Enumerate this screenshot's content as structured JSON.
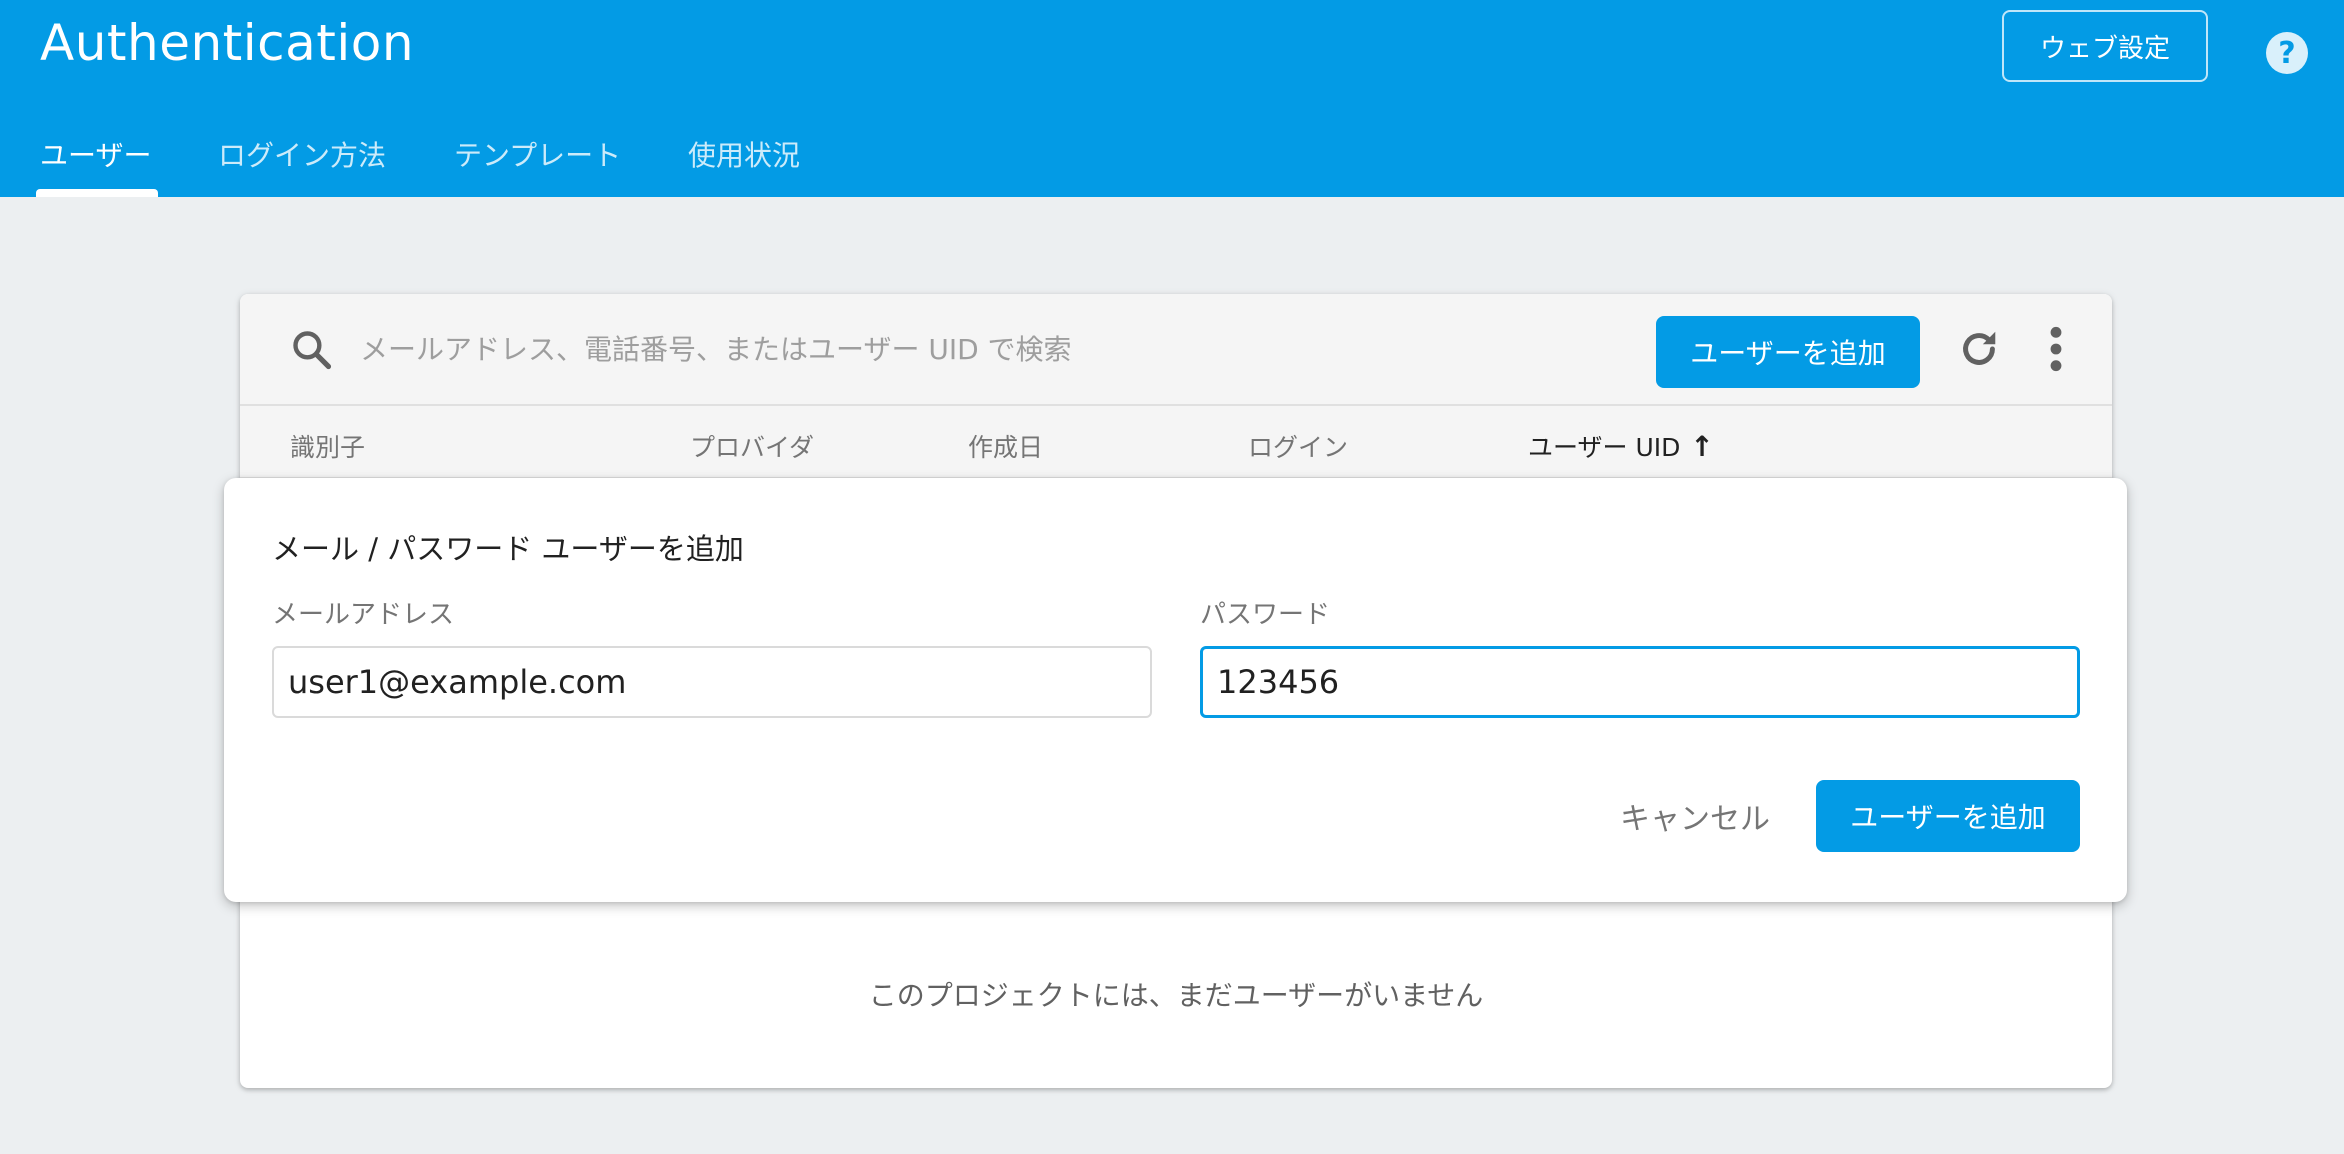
{
  "header": {
    "title": "Authentication",
    "web_settings_label": "ウェブ設定",
    "help_glyph": "?"
  },
  "tabs": [
    {
      "label": "ユーザー",
      "active": true
    },
    {
      "label": "ログイン方法",
      "active": false
    },
    {
      "label": "テンプレート",
      "active": false
    },
    {
      "label": "使用状況",
      "active": false
    }
  ],
  "toolbar": {
    "search_placeholder": "メールアドレス、電話番号、またはユーザー UID で検索",
    "add_user_label": "ユーザーを追加"
  },
  "table": {
    "columns": [
      "識別子",
      "プロバイダ",
      "作成日",
      "ログイン",
      "ユーザー UID"
    ],
    "sorted_column": "ユーザー UID",
    "sort_arrow": "↑",
    "empty_message": "このプロジェクトには、まだユーザーがいません"
  },
  "dialog": {
    "title": "メール / パスワード ユーザーを追加",
    "email_label": "メールアドレス",
    "email_value": "user1@example.com",
    "password_label": "パスワード",
    "password_value": "123456",
    "cancel_label": "キャンセル",
    "submit_label": "ユーザーを追加"
  },
  "colors": {
    "brand": "#039be5",
    "background": "#eceff1"
  }
}
